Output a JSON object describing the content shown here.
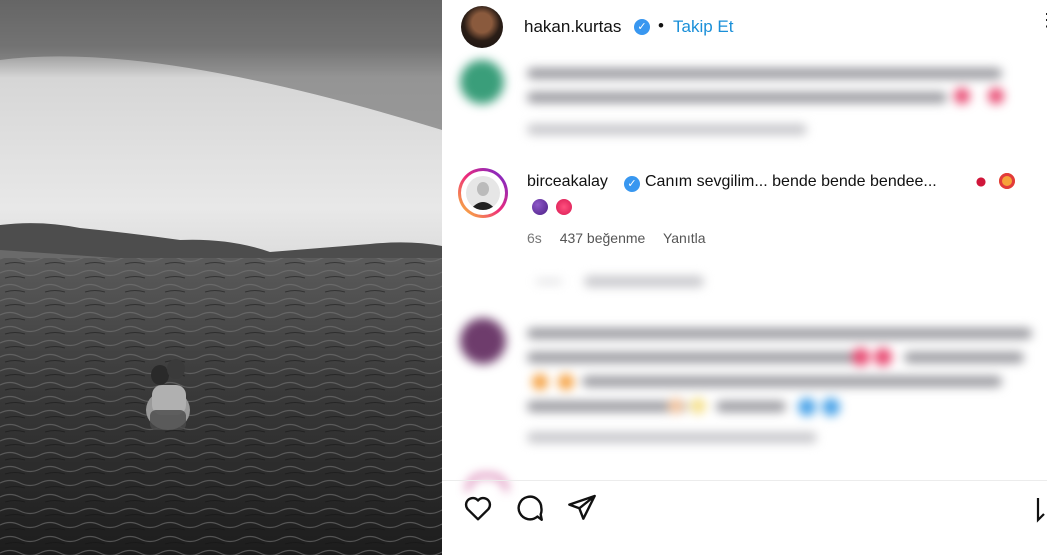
{
  "post": {
    "author_name": "hakan.kurtas",
    "author_verified_icon": "verified-badge-icon",
    "separator": "•",
    "follow_label": "Takip Et",
    "more_label": "..."
  },
  "comment": {
    "username": "birceakalay",
    "text": "Canım sevgilim... bende bende bendee...",
    "age": "6s",
    "likes": "437 beğenme",
    "reply_label": "Yanıtla"
  },
  "actions": {
    "like_icon": "heart-icon",
    "comment_icon": "comment-icon",
    "share_icon": "send-icon",
    "save_icon": "bookmark-icon"
  },
  "colors": {
    "accent": "#1a8fd8",
    "verified": "#3897f0"
  }
}
